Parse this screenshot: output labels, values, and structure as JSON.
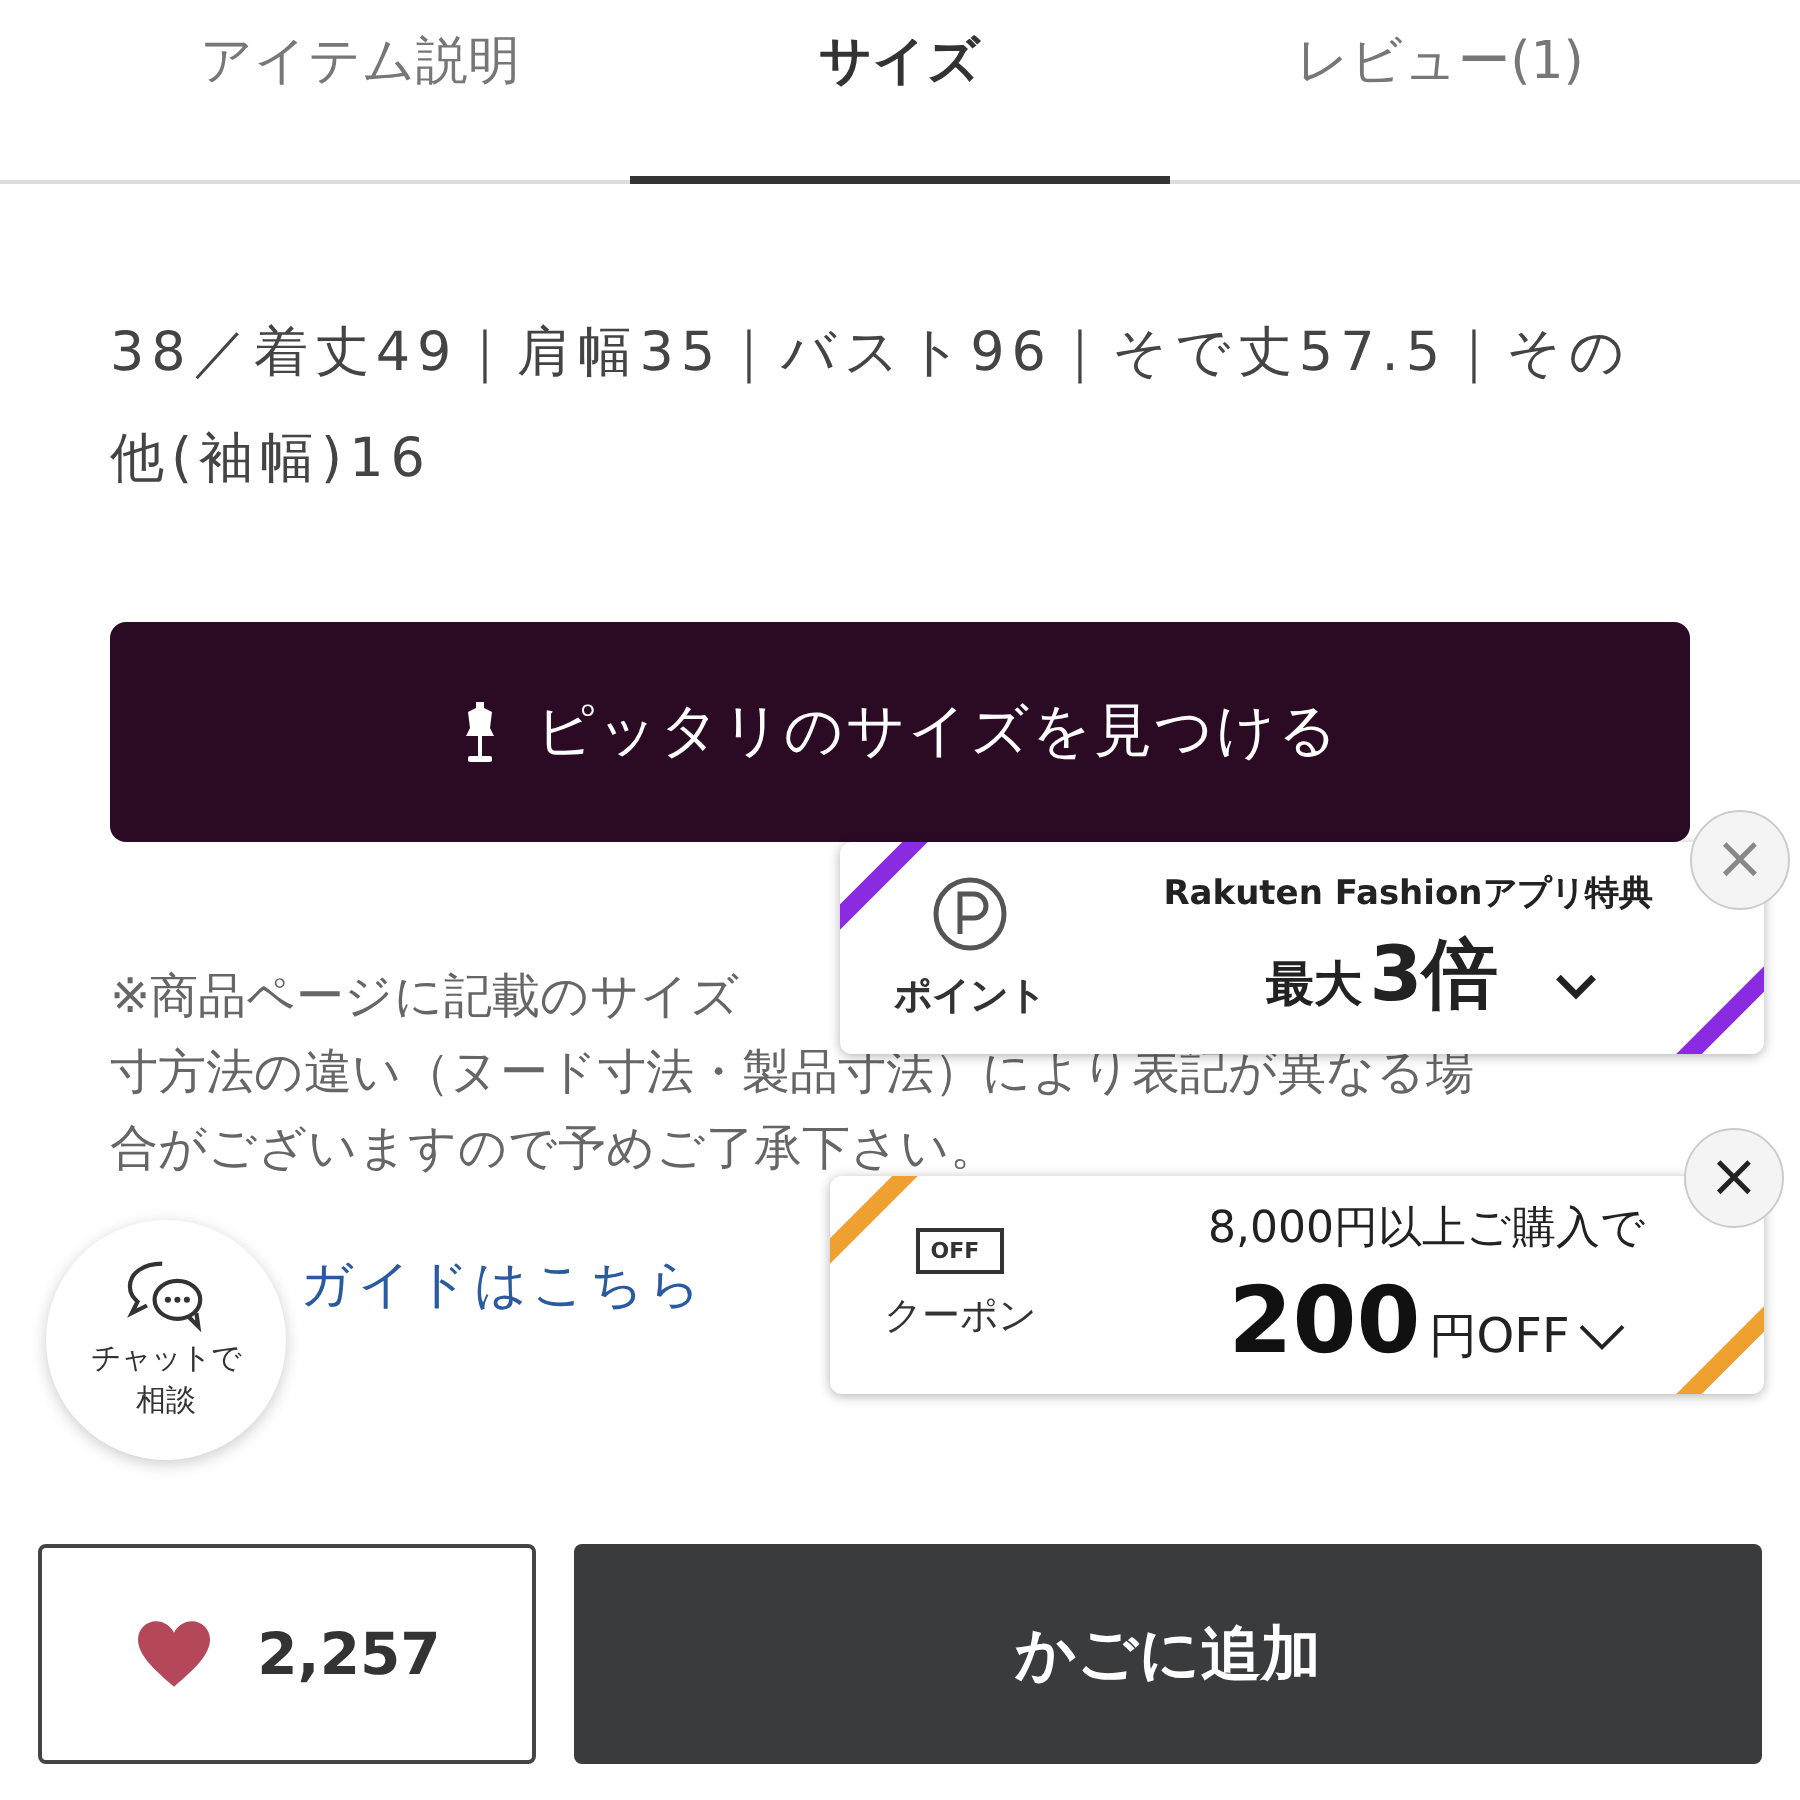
{
  "tabs": [
    {
      "label": "アイテム説明",
      "selected": false
    },
    {
      "label": "サイズ",
      "selected": true
    },
    {
      "label": "レビュー(1)",
      "selected": false
    }
  ],
  "size_text": "38／着丈49｜肩幅35｜バスト96｜そで丈57.5｜その他(袖幅)16",
  "fit_button": {
    "label": "ピッタリのサイズを見つける"
  },
  "notice_lines": [
    "※商品ページに記載のサイズ",
    "寸方法の違い（ヌード寸法・製品寸法）により表記が異なる場",
    "合がございますので予めご了承下さい。"
  ],
  "guide_link": "ガイドはこちら",
  "chat_button": {
    "label": "チャットで相談"
  },
  "point_banner": {
    "label": "ポイント",
    "title": "Rakuten Fashionアプリ特典",
    "prefix": "最大",
    "value": "3倍",
    "close": "×"
  },
  "coupon_banner": {
    "icon_text": "OFF",
    "label": "クーポン",
    "condition": "8,000円以上ご購入で",
    "value": "200",
    "unit": "円OFF",
    "close": "×"
  },
  "favorite": {
    "count": "2,257"
  },
  "cart_button": {
    "label": "かごに追加"
  }
}
